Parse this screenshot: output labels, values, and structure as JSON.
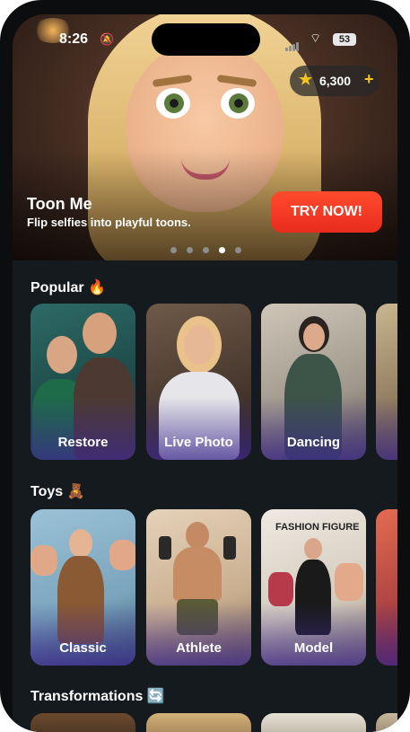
{
  "status_bar": {
    "time": "8:26",
    "battery": "53"
  },
  "wallet": {
    "coins": "6,300",
    "star_icon": "star-icon",
    "plus_icon": "plus-icon"
  },
  "hero": {
    "title": "Toon Me",
    "subtitle": "Flip selfies into playful toons.",
    "cta_label": "TRY NOW!",
    "cta_color": "#f03a22",
    "carousel_active_index": 3,
    "carousel_count": 5
  },
  "sections": [
    {
      "title": "Popular",
      "title_icon": "fire-icon",
      "title_emoji": "🔥",
      "cards": [
        {
          "label": "Restore"
        },
        {
          "label": "Live Photo"
        },
        {
          "label": "Dancing"
        },
        {
          "label": ""
        }
      ]
    },
    {
      "title": "Toys",
      "title_icon": "teddy-bear-icon",
      "title_emoji": "🧸",
      "cards": [
        {
          "label": "Classic"
        },
        {
          "label": "Athlete"
        },
        {
          "label": "Model"
        },
        {
          "label": ""
        }
      ]
    },
    {
      "title": "Transformations",
      "title_icon": "refresh-icon",
      "title_emoji": "🔄"
    }
  ],
  "card_text": {
    "fashion_box": "FASHION FIGURE"
  },
  "colors": {
    "background": "#151a1e",
    "accent": "#f7c51e",
    "card_fade": "#3c288c"
  }
}
